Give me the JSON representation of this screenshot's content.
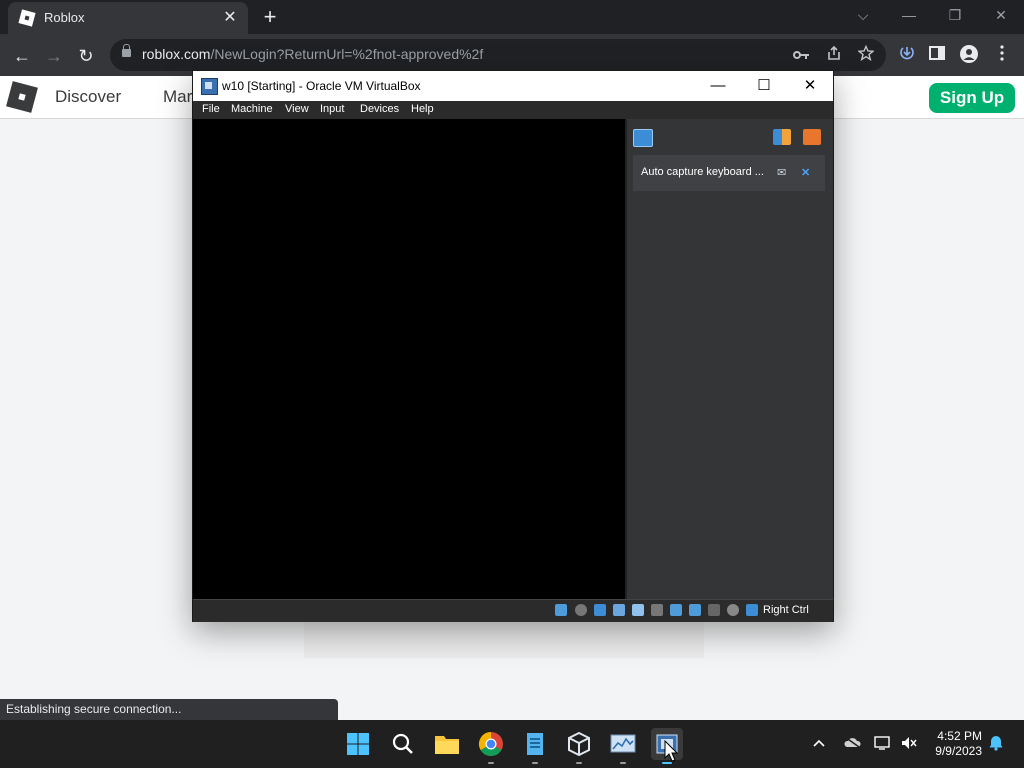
{
  "browser": {
    "tab_title": "Roblox",
    "tab_close": "✕",
    "new_tab": "+",
    "url_host": "roblox.com",
    "url_path": "/NewLogin?ReturnUrl=%2fnot-approved%2f",
    "window_controls": {
      "dropdown": "⌵",
      "minimize": "—",
      "restore": "❐",
      "close": "✕"
    },
    "nav": {
      "back": "←",
      "forward": "→",
      "reload": "↻"
    },
    "status": "Establishing secure connection..."
  },
  "page": {
    "nav_links": [
      "Discover",
      "Mar"
    ],
    "signup_label": "Sign Up"
  },
  "virtualbox": {
    "title": "w10 [Starting] - Oracle VM VirtualBox",
    "controls": {
      "minimize": "—",
      "maximize": "☐",
      "close": "✕"
    },
    "menu": [
      "File",
      "Machine",
      "View",
      "Input",
      "Devices",
      "Help"
    ],
    "notification": "Auto capture keyboard ...",
    "host_key": "Right Ctrl"
  },
  "taskbar": {
    "time": "4:52 PM",
    "date": "9/9/2023"
  },
  "colors": {
    "signup": "#00b06f",
    "chrome_dark": "#202124",
    "vbox_panel": "#333537"
  }
}
